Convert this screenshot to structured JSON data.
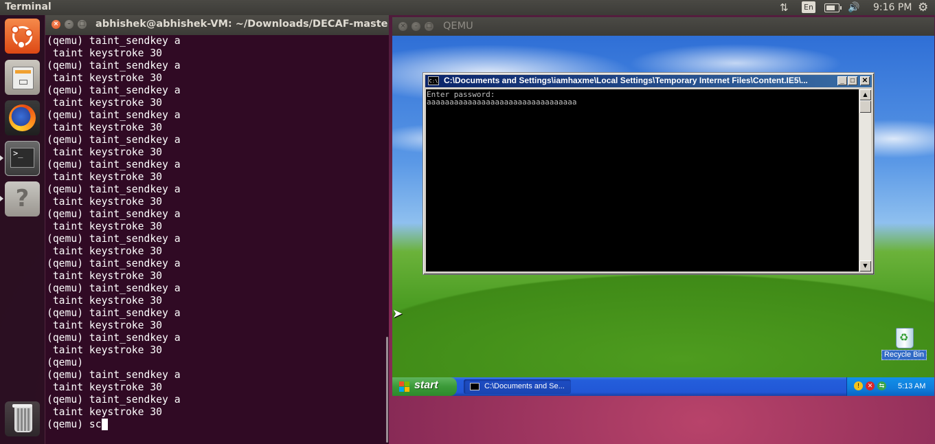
{
  "top_panel": {
    "app_title": "Terminal",
    "keyboard_layout": "En",
    "time": "9:16 PM",
    "network_glyph": "⇅",
    "sound_glyph": "🔊",
    "settings_glyph": "⚙"
  },
  "launcher": {
    "items": [
      {
        "name": "ubuntu-dash-icon"
      },
      {
        "name": "files-icon"
      },
      {
        "name": "firefox-icon"
      },
      {
        "name": "terminal-icon",
        "glyph": ">_"
      },
      {
        "name": "help-icon",
        "glyph": "?"
      },
      {
        "name": "trash-icon"
      }
    ]
  },
  "terminal": {
    "title": "abhishek@abhishek-VM: ~/Downloads/DECAF-master/decaf",
    "lines": [
      "(qemu) taint_sendkey a",
      " taint keystroke 30",
      "(qemu) taint_sendkey a",
      " taint keystroke 30",
      "(qemu) taint_sendkey a",
      " taint keystroke 30",
      "(qemu) taint_sendkey a",
      " taint keystroke 30",
      "(qemu) taint_sendkey a",
      " taint keystroke 30",
      "(qemu) taint_sendkey a",
      " taint keystroke 30",
      "(qemu) taint_sendkey a",
      " taint keystroke 30",
      "(qemu) taint_sendkey a",
      " taint keystroke 30",
      "(qemu) taint_sendkey a",
      " taint keystroke 30",
      "(qemu) taint_sendkey a",
      " taint keystroke 30",
      "(qemu) taint_sendkey a",
      " taint keystroke 30",
      "(qemu) taint_sendkey a",
      " taint keystroke 30",
      "(qemu) taint_sendkey a",
      " taint keystroke 30",
      "(qemu)",
      "(qemu) taint_sendkey a",
      " taint keystroke 30",
      "(qemu) taint_sendkey a",
      " taint keystroke 30"
    ],
    "prompt_line": "(qemu) sc"
  },
  "qemu": {
    "title": "QEMU",
    "cmd_window": {
      "title": "C:\\Documents and Settings\\iamhaxme\\Local Settings\\Temporary Internet Files\\Content.IE5\\...",
      "icon_text": "C:\\",
      "console_lines": [
        "Enter password:",
        "aaaaaaaaaaaaaaaaaaaaaaaaaaaaaaaaa"
      ],
      "minimize_label": "_",
      "maximize_label": "□",
      "close_label": "✕"
    },
    "recycle_bin_label": "Recycle Bin",
    "taskbar": {
      "start_label": "start",
      "task_label": "C:\\Documents and Se...",
      "clock": "5:13 AM"
    }
  }
}
